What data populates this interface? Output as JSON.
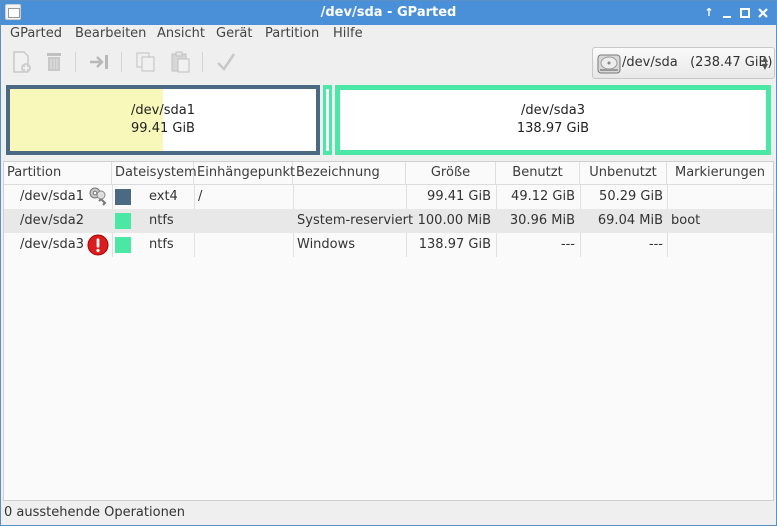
{
  "window": {
    "title": "/dev/sda - GParted"
  },
  "menubar": [
    "GParted",
    "Bearbeiten",
    "Ansicht",
    "Gerät",
    "Partition",
    "Hilfe"
  ],
  "toolbar": {
    "buttons": [
      "new-partition",
      "delete",
      "resize-move",
      "copy",
      "paste",
      "apply"
    ],
    "device": "/dev/sda",
    "device_size": "(238.47 GiB)"
  },
  "graph": {
    "sda1": {
      "name": "/dev/sda1",
      "size": "99.41 GiB",
      "used_fraction": 0.5,
      "fs_color": "#4b6983",
      "used_color": "#f8f8ba"
    },
    "sda3": {
      "name": "/dev/sda3",
      "size": "138.97 GiB",
      "fs_color": "#4be8a5"
    }
  },
  "table": {
    "headers": [
      "Partition",
      "Dateisystem",
      "Einhängepunkt",
      "Bezeichnung",
      "Größe",
      "Benutzt",
      "Unbenutzt",
      "Markierungen"
    ],
    "rows": [
      {
        "partition": "/dev/sda1",
        "icon": "key-icon",
        "fs": "ext4",
        "fs_color": "#4b6983",
        "mount": "/",
        "label": "",
        "size": "99.41 GiB",
        "used": "49.12 GiB",
        "unused": "50.29 GiB",
        "flags": ""
      },
      {
        "partition": "/dev/sda2",
        "icon": "",
        "fs": "ntfs",
        "fs_color": "#4be8a5",
        "mount": "",
        "label": "System-reserviert",
        "size": "100.00 MiB",
        "used": "30.96 MiB",
        "unused": "69.04 MiB",
        "flags": "boot"
      },
      {
        "partition": "/dev/sda3",
        "icon": "warning-icon",
        "fs": "ntfs",
        "fs_color": "#4be8a5",
        "mount": "",
        "label": "Windows",
        "size": "138.97 GiB",
        "used": "---",
        "unused": "---",
        "flags": ""
      }
    ]
  },
  "statusbar": {
    "text": "0 ausstehende Operationen"
  }
}
